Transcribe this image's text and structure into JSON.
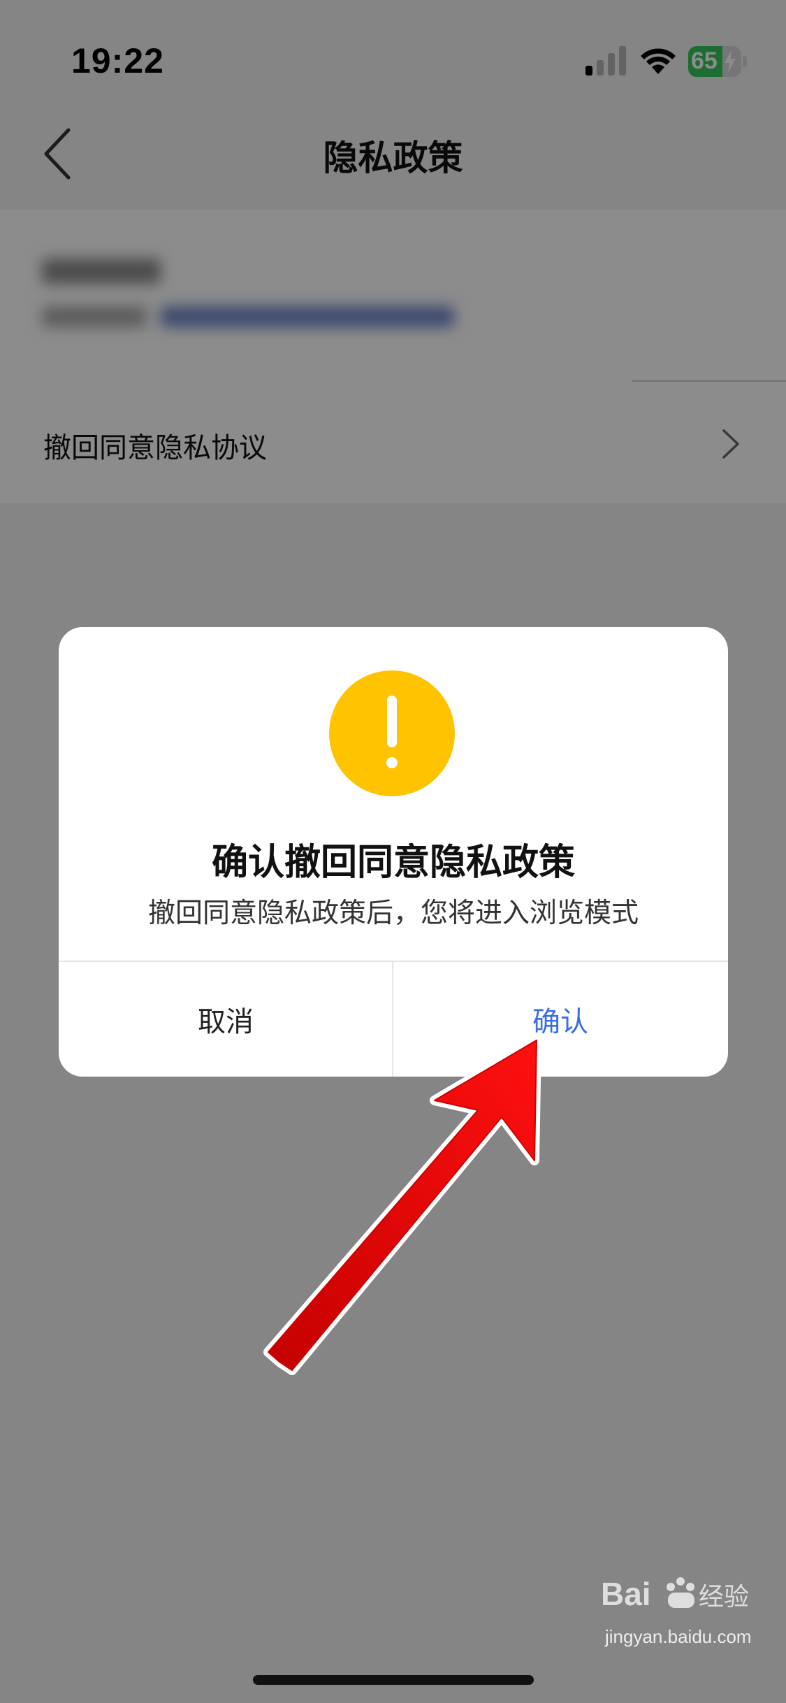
{
  "status_bar": {
    "time": "19:22",
    "battery_level": "65",
    "battery_color": "#34c759"
  },
  "nav": {
    "title": "隐私政策"
  },
  "list": {
    "withdraw_label": "撤回同意隐私协议"
  },
  "dialog": {
    "icon": "warning-exclamation-icon",
    "icon_color": "#ffc300",
    "title": "确认撤回同意隐私政策",
    "message": "撤回同意隐私政策后，您将进入浏览模式",
    "cancel_label": "取消",
    "confirm_label": "确认",
    "confirm_color": "#3a6ee8"
  },
  "watermark": {
    "url": "jingyan.baidu.com",
    "logo_text": "Baidu经验"
  }
}
